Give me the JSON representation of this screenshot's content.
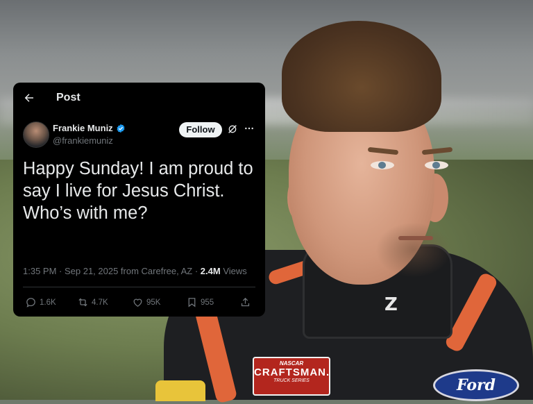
{
  "header": {
    "title": "Post",
    "back_icon": "arrow-left-icon"
  },
  "author": {
    "display_name": "Frankie Muniz",
    "handle": "@frankiemuniz",
    "verified": true,
    "verified_color": "#1d9bf0"
  },
  "follow_label": "Follow",
  "tweet": {
    "text": "Happy Sunday! I am proud to say I live for Jesus Christ. Who’s with me?",
    "meta_prefix": "1:35 PM · Sep 21, 2025 from Carefree, AZ · ",
    "views_count": "2.4M",
    "views_label": " Views"
  },
  "actions": {
    "replies": "1.6K",
    "reposts": "4.7K",
    "likes": "95K",
    "bookmarks": "955"
  },
  "photo": {
    "collar_logo": "Z",
    "patch_line1": "NASCAR",
    "patch_line2": "CRAFTSMAN.",
    "patch_line3": "TRUCK SERIES",
    "sponsor_logo": "Ford",
    "accent_orange": "#e0663a"
  }
}
